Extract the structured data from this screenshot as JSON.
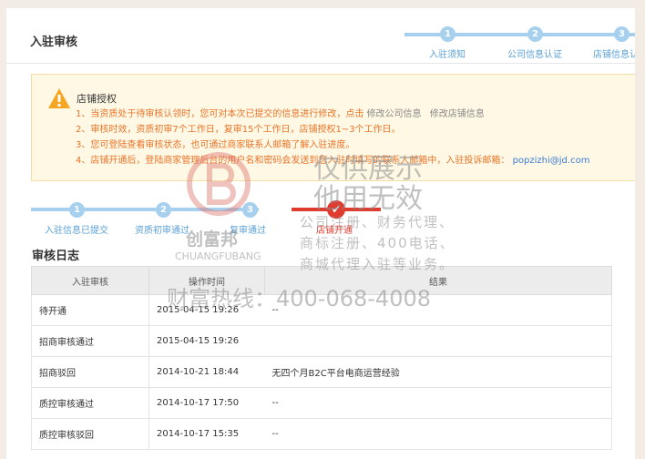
{
  "header": {
    "title": "入驻审核"
  },
  "top_steps": [
    {
      "num": "1",
      "label": "入驻须知"
    },
    {
      "num": "2",
      "label": "公司信息认证"
    },
    {
      "num": "3",
      "label": "店铺信息认"
    }
  ],
  "notice": {
    "title": "店铺授权",
    "items": [
      {
        "text": "1、当资质处于待审核认领时，您可对本次已提交的信息进行修改，点击",
        "link1": "修改公司信息",
        "link2": "修改店铺信息"
      },
      {
        "text": "2、审核时效，资质初审7个工作日，复审15个工作日，店铺授权1~3个工作日。"
      },
      {
        "text": "3、您可登陆查看审核状态，也可通过商家联系人邮箱了解入驻进度。"
      },
      {
        "text": "4、店铺开通后，登陆商家管理后台的用户名和密码会发送到您入驻时填写的联系人邮箱中，入驻投诉邮箱：",
        "email": "popzizhi@jd.com"
      }
    ]
  },
  "progress": {
    "steps": [
      {
        "num": "1",
        "label": "入驻信息已提交"
      },
      {
        "num": "2",
        "label": "资质初审通过"
      },
      {
        "num": "3",
        "label": "复审通过"
      },
      {
        "num": "✔",
        "label": "店铺开通"
      }
    ]
  },
  "log": {
    "title": "审核日志",
    "columns": [
      "入驻审核",
      "操作时间",
      "结果"
    ],
    "rows": [
      [
        "待开通",
        "2015-04-15 19:26",
        "--"
      ],
      [
        "招商审核通过",
        "2015-04-15 19:26",
        ""
      ],
      [
        "招商驳回",
        "2014-10-21 18:44",
        "无四个月B2C平台电商运营经验"
      ],
      [
        "质控审核通过",
        "2014-10-17 17:50",
        "--"
      ],
      [
        "质控审核驳回",
        "2014-10-17 15:35",
        "--"
      ]
    ]
  },
  "watermark": {
    "logo_text": "创富邦",
    "logo_sub": "CHUANGFUBANG",
    "line1": "仅供展示",
    "line2": "他用无效",
    "line3": "公司注册、财务代理、",
    "line4": "商标注册、400电话、",
    "line5": "商城代理入驻等业务。",
    "hotline": "财富热线：400-068-4008"
  }
}
